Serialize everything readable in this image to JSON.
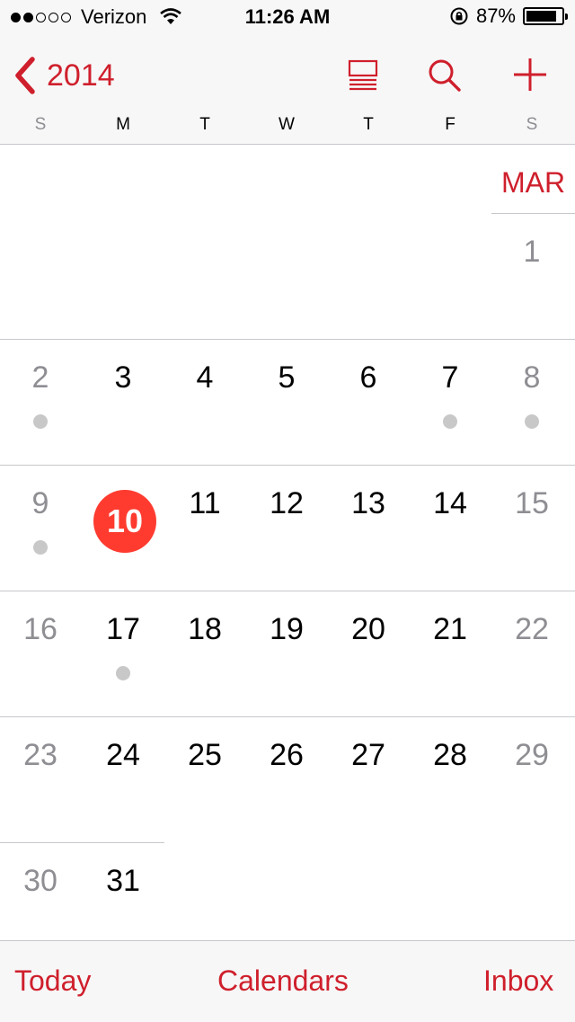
{
  "status_bar": {
    "signal_bars_filled": 2,
    "signal_bars_total": 5,
    "carrier": "Verizon",
    "time": "11:26 AM",
    "battery_percent": "87%",
    "battery_level": 0.87,
    "icons": [
      "wifi-icon",
      "rotation-lock-icon",
      "battery-icon"
    ]
  },
  "nav": {
    "back_label": "2014",
    "accent_color": "#cf1f2c",
    "icons": [
      "list-view-icon",
      "search-icon",
      "add-icon"
    ]
  },
  "weekdays": [
    "S",
    "M",
    "T",
    "W",
    "T",
    "F",
    "S"
  ],
  "calendar": {
    "month_label": "MAR",
    "today": "10",
    "today_color": "#ff3b30",
    "event_dot_days": [
      "2",
      "7",
      "8",
      "9",
      "17"
    ],
    "weeks": [
      [
        "",
        "",
        "",
        "",
        "",
        "",
        "1"
      ],
      [
        "2",
        "3",
        "4",
        "5",
        "6",
        "7",
        "8"
      ],
      [
        "9",
        "10",
        "11",
        "12",
        "13",
        "14",
        "15"
      ],
      [
        "16",
        "17",
        "18",
        "19",
        "20",
        "21",
        "22"
      ],
      [
        "23",
        "24",
        "25",
        "26",
        "27",
        "28",
        "29"
      ],
      [
        "30",
        "31",
        "",
        "",
        "",
        "",
        ""
      ]
    ]
  },
  "toolbar": {
    "today_label": "Today",
    "calendars_label": "Calendars",
    "inbox_label": "Inbox"
  }
}
